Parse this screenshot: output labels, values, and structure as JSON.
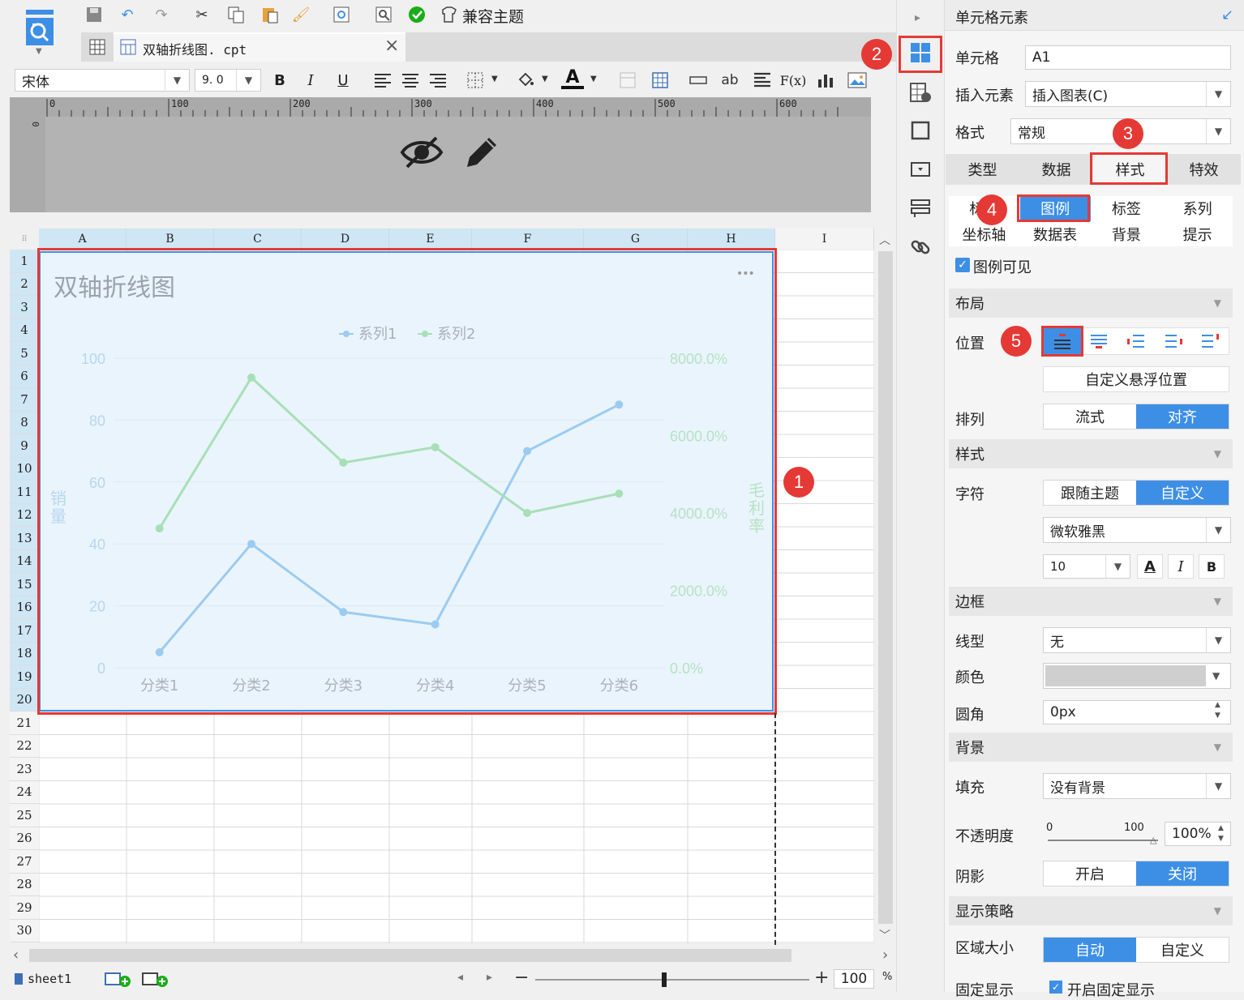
{
  "toolbar": {
    "compat_theme": "兼容主题"
  },
  "tab": {
    "filename": "双轴折线图. cpt",
    "close": "×"
  },
  "format": {
    "font": "宋体",
    "size": "9. 0",
    "bold": "B",
    "italic": "I",
    "underline": "U",
    "font_color": "A",
    "ab": "ab",
    "fx": "F(x)"
  },
  "ruler": {
    "ticks": [
      "0",
      "100",
      "200",
      "300",
      "400",
      "500",
      "600"
    ],
    "vertical_zero": "0"
  },
  "sheet": {
    "columns": [
      "A",
      "B",
      "C",
      "D",
      "E",
      "F",
      "G",
      "H",
      "I"
    ],
    "rows": [
      "1",
      "2",
      "3",
      "4",
      "5",
      "6",
      "7",
      "8",
      "9",
      "10",
      "11",
      "12",
      "13",
      "14",
      "15",
      "16",
      "17",
      "18",
      "19",
      "20",
      "21",
      "22",
      "23",
      "24",
      "25",
      "26",
      "27",
      "28",
      "29",
      "30"
    ],
    "tab_name": "sheet1",
    "zoom": "100",
    "zoom_unit": "%"
  },
  "chart_data": {
    "type": "line",
    "title": "双轴折线图",
    "categories": [
      "分类1",
      "分类2",
      "分类3",
      "分类4",
      "分类5",
      "分类6"
    ],
    "series": [
      {
        "name": "系列1",
        "axis": "left",
        "color": "#9ccbf0",
        "values": [
          5,
          40,
          18,
          14,
          70,
          85
        ]
      },
      {
        "name": "系列2",
        "axis": "right",
        "color": "#a8dfb8",
        "values": [
          3600,
          7500,
          5300,
          5700,
          4000,
          4500
        ]
      }
    ],
    "ylabel": "销量",
    "y2label": "毛利率",
    "ylim": [
      0,
      100
    ],
    "y2lim": [
      0,
      8000
    ],
    "yticks": [
      "0",
      "20",
      "40",
      "60",
      "80",
      "100"
    ],
    "y2ticks": [
      "0.0%",
      "2000.0%",
      "4000.0%",
      "6000.0%",
      "8000.0%"
    ],
    "legend": "top-center",
    "more": "•••"
  },
  "panel": {
    "title": "单元格元素",
    "cell_label": "单元格",
    "cell_value": "A1",
    "insert_label": "插入元素",
    "insert_value": "插入图表(C)",
    "format_label": "格式",
    "format_value": "常规",
    "tabs": [
      "类型",
      "数据",
      "样式",
      "特效"
    ],
    "subtabs_row1": [
      "标题",
      "图例",
      "标签",
      "系列"
    ],
    "subtabs_row2": [
      "坐标轴",
      "数据表",
      "背景",
      "提示"
    ],
    "legend_visible": "图例可见",
    "layout_section": "布局",
    "position_label": "位置",
    "custom_float": "自定义悬浮位置",
    "arrange_label": "排列",
    "arrange_options": [
      "流式",
      "对齐"
    ],
    "style_section": "样式",
    "char_label": "字符",
    "char_options": [
      "跟随主题",
      "自定义"
    ],
    "font_value": "微软雅黑",
    "font_size": "10",
    "fmt_a": "A",
    "fmt_i": "I",
    "fmt_b": "B",
    "border_section": "边框",
    "line_label": "线型",
    "line_value": "无",
    "color_label": "颜色",
    "radius_label": "圆角",
    "radius_value": "0px",
    "bg_section": "背景",
    "fill_label": "填充",
    "fill_value": "没有背景",
    "opacity_label": "不透明度",
    "opacity_min": "0",
    "opacity_max": "100",
    "opacity_value": "100%",
    "shadow_label": "阴影",
    "shadow_options": [
      "开启",
      "关闭"
    ],
    "display_section": "显示策略",
    "area_label": "区域大小",
    "area_options": [
      "自动",
      "自定义"
    ],
    "fixed_label": "固定显示",
    "fixed_check": "开启固定显示"
  },
  "badges": [
    "1",
    "2",
    "3",
    "4",
    "5"
  ],
  "colors": {
    "accent": "#3d8fe6",
    "highlight": "#e53935",
    "chart_bg": "#eaf4fc"
  }
}
